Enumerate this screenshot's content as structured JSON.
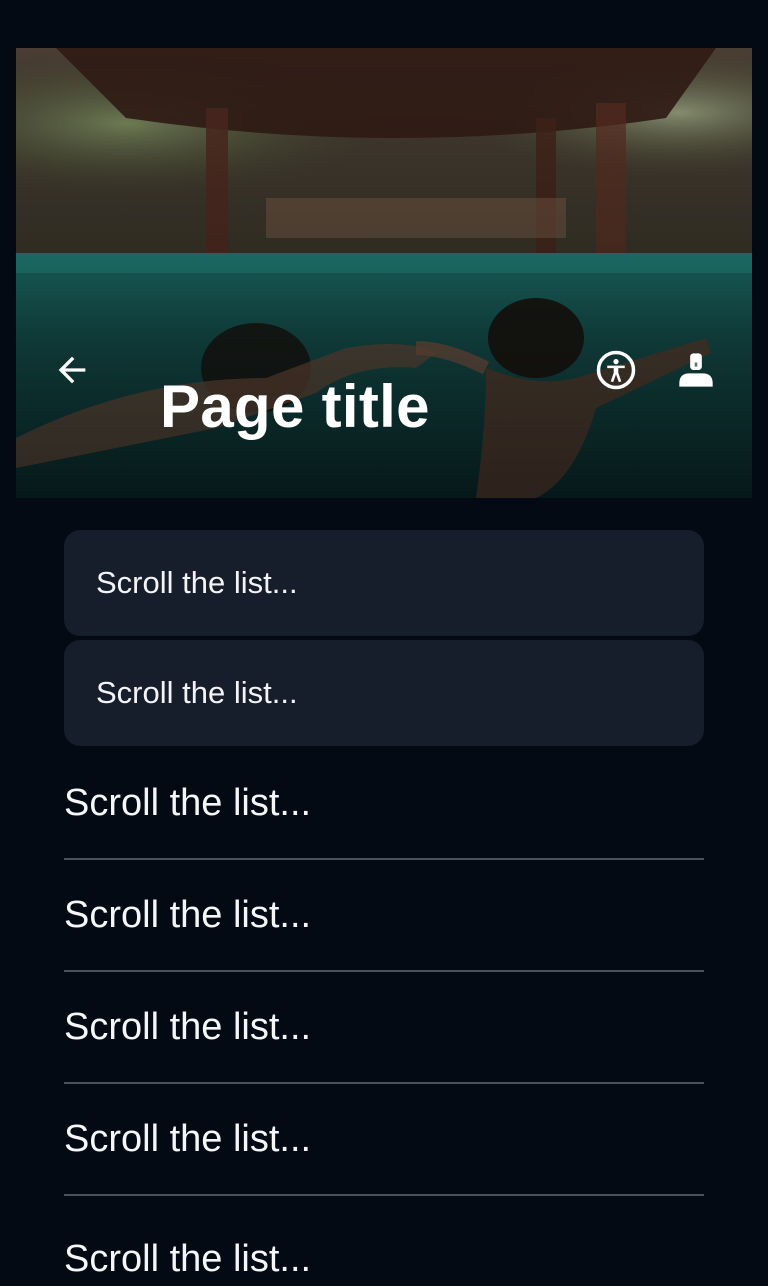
{
  "app_bar": {
    "title": "Page title",
    "back_icon": "arrow-back-icon",
    "accessibility_icon": "accessibility-icon",
    "account_icon": "person-icon"
  },
  "colors": {
    "background": "#030a14",
    "card": "#161d2b",
    "divider": "#4a525c",
    "text": "#ffffff"
  },
  "cards": [
    {
      "label": "Scroll the list..."
    },
    {
      "label": "Scroll the list..."
    }
  ],
  "list_items": [
    {
      "label": "Scroll the list..."
    },
    {
      "label": "Scroll the list..."
    },
    {
      "label": "Scroll the list..."
    },
    {
      "label": "Scroll the list..."
    },
    {
      "label": "Scroll the list..."
    }
  ]
}
